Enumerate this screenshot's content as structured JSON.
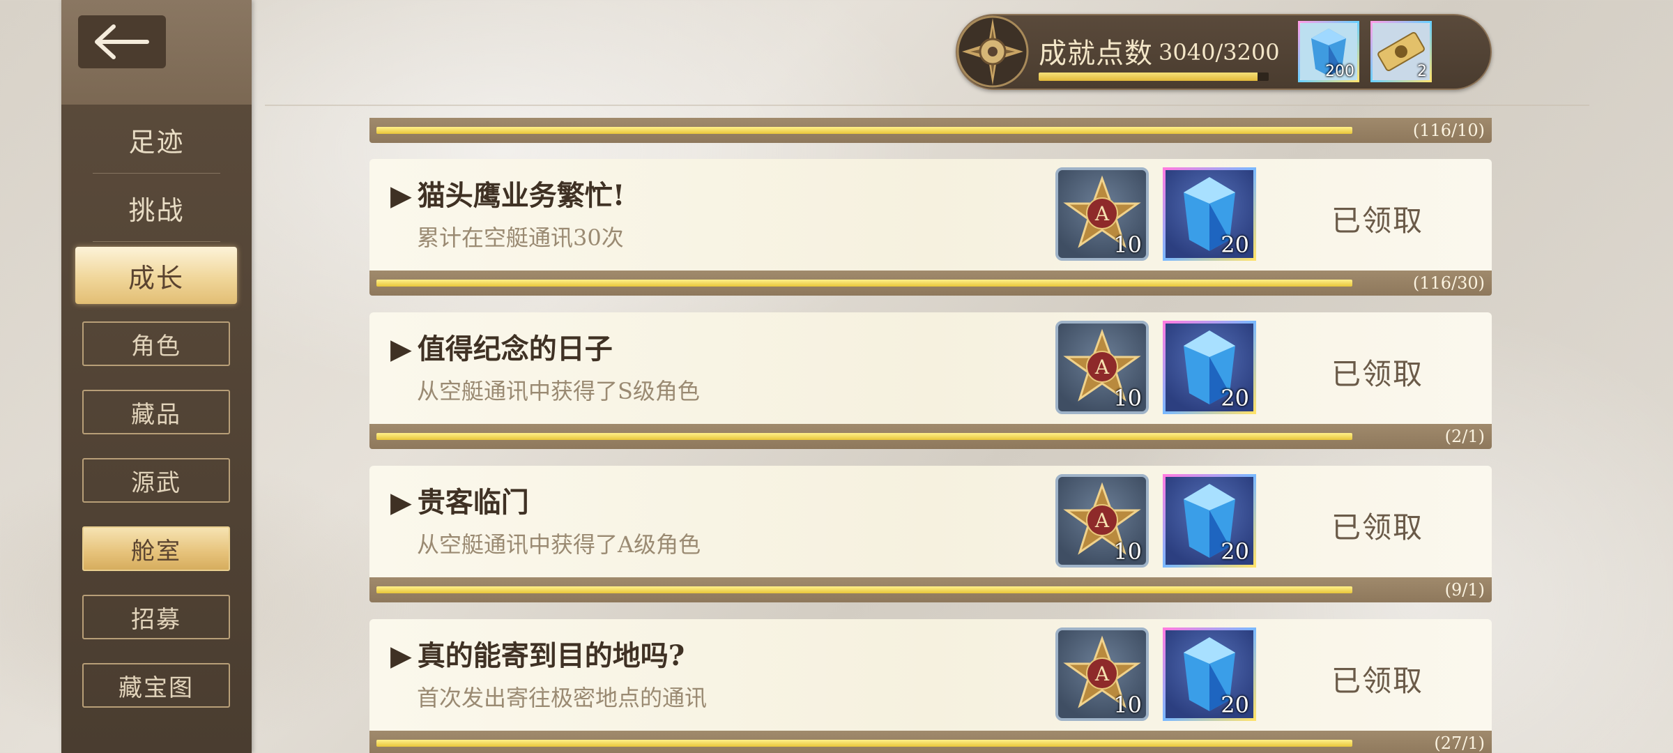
{
  "header": {
    "points_label": "成就点数",
    "points_value": "3040/3200",
    "points_progress": 0.95,
    "currencies": [
      {
        "icon": "blue-crystal-icon",
        "count": "200"
      },
      {
        "icon": "gold-ticket-icon",
        "count": "2"
      }
    ]
  },
  "sidebar": {
    "main": [
      "足迹",
      "挑战",
      "成长"
    ],
    "sub": [
      "角色",
      "藏品",
      "源武",
      "舱室",
      "招募",
      "藏宝图"
    ]
  },
  "list": {
    "top_progress": "(116/10)",
    "items": [
      {
        "title": "猫头鹰业务繁忙!",
        "desc": "累计在空艇通讯30次",
        "reward_badge": "10",
        "reward_crystal": "20",
        "status": "已领取",
        "progress": "(116/30)"
      },
      {
        "title": "值得纪念的日子",
        "desc": "从空艇通讯中获得了S级角色",
        "reward_badge": "10",
        "reward_crystal": "20",
        "status": "已领取",
        "progress": "(2/1)"
      },
      {
        "title": "贵客临门",
        "desc": "从空艇通讯中获得了A级角色",
        "reward_badge": "10",
        "reward_crystal": "20",
        "status": "已领取",
        "progress": "(9/1)"
      },
      {
        "title": "真的能寄到目的地吗?",
        "desc": "首次发出寄往极密地点的通讯",
        "reward_badge": "10",
        "reward_crystal": "20",
        "status": "已领取",
        "progress": "(27/1)"
      }
    ],
    "reward_badge_letter": "A"
  }
}
